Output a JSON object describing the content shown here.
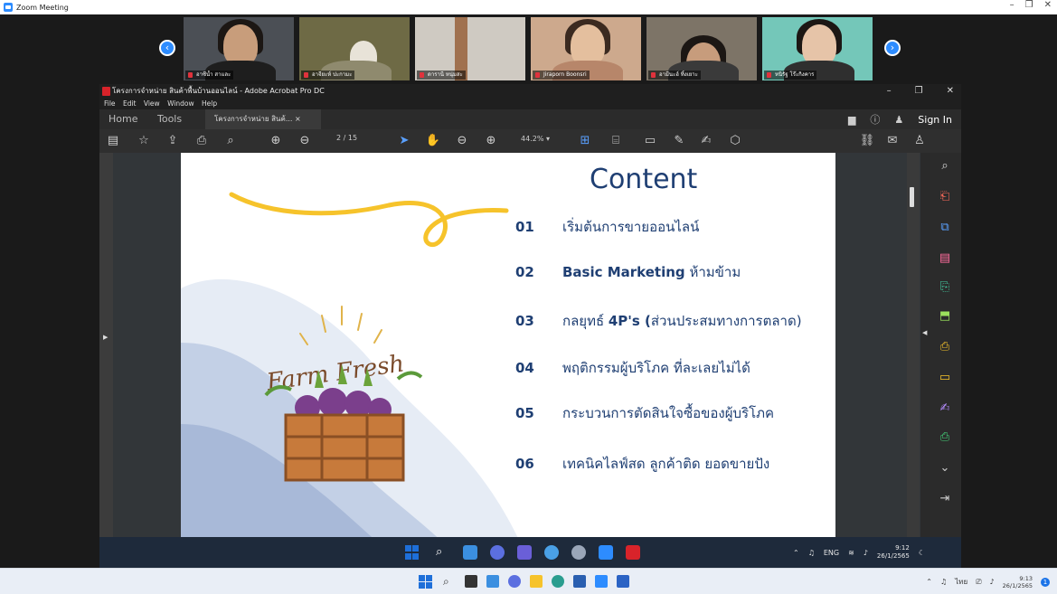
{
  "zoom": {
    "window_title": "Zoom Meeting",
    "controls": [
      "–",
      "❐",
      "✕"
    ]
  },
  "participants": [
    {
      "name": "อาซีน้ำ สาและ"
    },
    {
      "name": "อาจียะห์ ปะกามะ"
    },
    {
      "name": "ดารานี หนุ่มสะ"
    },
    {
      "name": "Jiraporn Boonsri"
    },
    {
      "name": "อามีนะฮ์ ทิ้งเยาะ"
    },
    {
      "name": "หนิรัฐ โร๊ะกิงคาร"
    }
  ],
  "acrobat": {
    "title": "โครงการจำหน่าย สินค้าพื้นบ้านออนไลน์ - Adobe Acrobat Pro DC",
    "menu": [
      "File",
      "Edit",
      "View",
      "Window",
      "Help"
    ],
    "tabs": {
      "home": "Home",
      "tools": "Tools",
      "doc": "โครงการจำหน่าย สินค้... ×"
    },
    "sign_in": "Sign In",
    "page_indicator": "2  /  15",
    "zoom_level": "44.2%  ▾"
  },
  "slide": {
    "title": "Content",
    "logo_text": "Farm Fresh",
    "items": [
      {
        "num": "01",
        "pre": "เริ่มต้นการขายออนไลน์",
        "bold": "",
        "post": ""
      },
      {
        "num": "02",
        "pre": "",
        "bold": "Basic Marketing",
        "post": " ห้ามข้าม"
      },
      {
        "num": "03",
        "pre": "กลยุทธ์ ",
        "bold": "4P's (",
        "post": "ส่วนประสมทางการตลาด)"
      },
      {
        "num": "04",
        "pre": "พฤติกรรมผู้บริโภค ที่ละเลยไม่ได้",
        "bold": "",
        "post": ""
      },
      {
        "num": "05",
        "pre": "กระบวนการตัดสินใจซื้อของผู้บริโภค",
        "bold": "",
        "post": ""
      },
      {
        "num": "06",
        "pre": "เทคนิคไลฟ์สด ลูกค้าติด ยอดขายปัง",
        "bold": "",
        "post": ""
      }
    ]
  },
  "inner_taskbar": {
    "lang": "ENG",
    "time": "9:12",
    "date": "26/1/2565"
  },
  "taskbar": {
    "lang": "ไทย",
    "time": "9:13",
    "date": "26/1/2565",
    "badge": "1"
  },
  "colors": {
    "accent_blue": "#1f3f73",
    "zoom_blue": "#2d8cff",
    "acrobat_red": "#d8232a"
  }
}
